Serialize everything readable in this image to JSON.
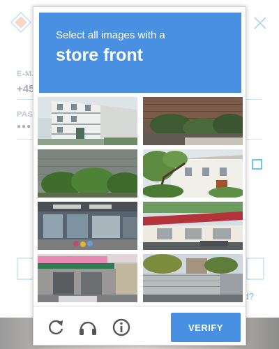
{
  "background_page": {
    "email_label": "E-MA",
    "phone_value": "+45",
    "password_label": "PASS",
    "password_mask": "●●●",
    "forgot_text": "ord?"
  },
  "captcha": {
    "prompt": "Select all images with a",
    "target": "store front",
    "tiles": [
      {
        "scene": "white apartment building"
      },
      {
        "scene": "brick wall with hedge"
      },
      {
        "scene": "wall with green trees"
      },
      {
        "scene": "tree and white house"
      },
      {
        "scene": "store front with awning"
      },
      {
        "scene": "building with red awning"
      },
      {
        "scene": "store front with pink sign"
      },
      {
        "scene": "street with fence and houses"
      }
    ],
    "verify_label": "VERIFY",
    "icons": [
      "reload-icon",
      "audio-icon",
      "info-icon"
    ],
    "accent_color": "#4a90e2"
  }
}
